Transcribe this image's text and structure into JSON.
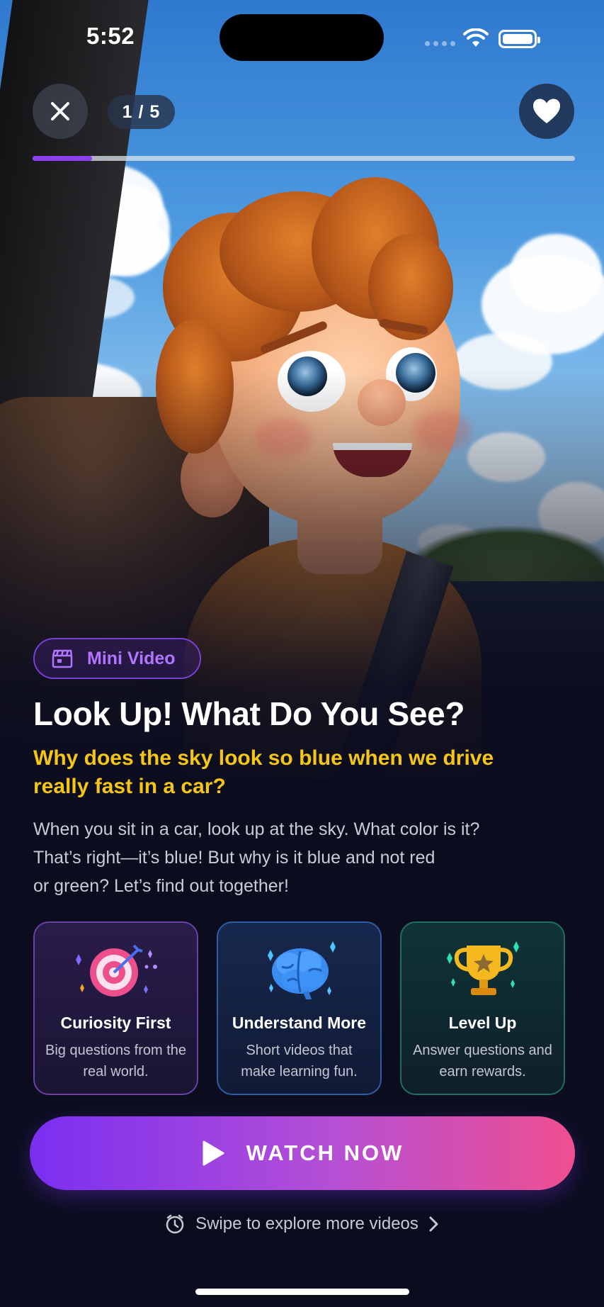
{
  "status_bar": {
    "time": "5:52"
  },
  "header": {
    "counter": "1 / 5",
    "progress_fraction": 0.11
  },
  "badge": {
    "label": "Mini Video"
  },
  "content": {
    "title": "Look Up! What Do You See?",
    "subtitle": "Why does the sky look so blue when we drive really fast in a car?",
    "description_lines": [
      "When you sit in a car, look up at the sky. What color is it?",
      "That’s right—it’s blue! But why is it blue and not red",
      "or green? Let’s find out together!"
    ]
  },
  "cards": [
    {
      "icon": "target-icon",
      "title": "Curiosity First",
      "text": "Big questions from the real world.",
      "accent": "#6a3fa8"
    },
    {
      "icon": "brain-icon",
      "title": "Understand More",
      "text": "Short videos that make learning fun.",
      "accent": "#2f5ca8"
    },
    {
      "icon": "trophy-icon",
      "title": "Level Up",
      "text": "Answer questions and earn rewards.",
      "accent": "#1f6e62"
    }
  ],
  "cta": {
    "label": "WATCH NOW"
  },
  "footer": {
    "swipe_text": "Swipe to explore more videos"
  },
  "colors": {
    "accent_purple": "#8b3ff0",
    "subtitle_yellow": "#f5c518",
    "background": "#0b0d1f"
  }
}
